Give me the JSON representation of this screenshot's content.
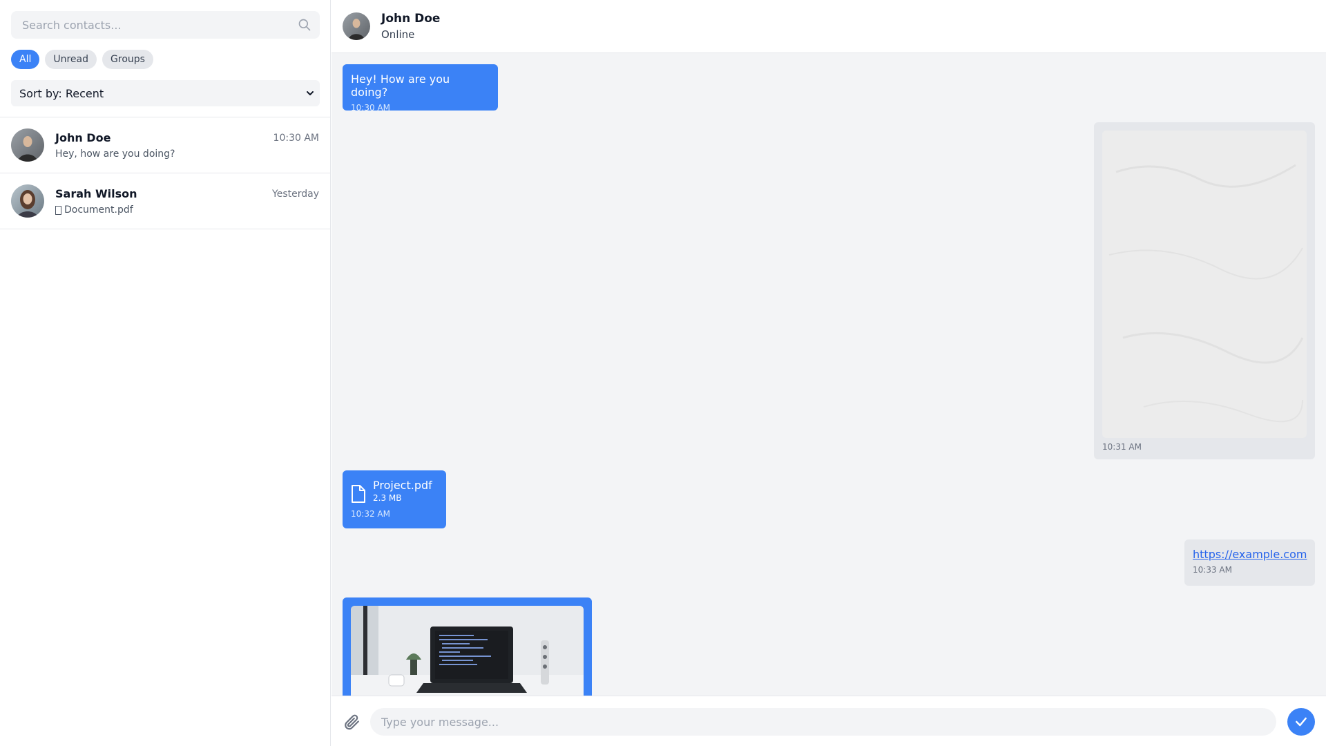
{
  "sidebar": {
    "search": {
      "placeholder": "Search contacts...",
      "value": ""
    },
    "filters": [
      {
        "label": "All",
        "active": true
      },
      {
        "label": "Unread",
        "active": false
      },
      {
        "label": "Groups",
        "active": false
      }
    ],
    "sort": {
      "selected": "Sort by: Recent"
    },
    "contacts": [
      {
        "name": "John Doe",
        "time": "10:30 AM",
        "preview": "Hey, how are you doing?"
      },
      {
        "name": "Sarah Wilson",
        "time": "Yesterday",
        "preview": "Document.pdf"
      }
    ]
  },
  "chat": {
    "header": {
      "name": "John Doe",
      "status": "Online"
    },
    "messages": [
      {
        "type": "text",
        "direction": "incoming",
        "text": "Hey! How are you doing?",
        "time": "10:30 AM"
      },
      {
        "type": "image",
        "direction": "outgoing",
        "time": "10:31 AM"
      },
      {
        "type": "file",
        "direction": "incoming",
        "file_name": "Project.pdf",
        "file_size": "2.3 MB",
        "time": "10:32 AM"
      },
      {
        "type": "link",
        "direction": "outgoing",
        "url": "https://example.com",
        "time": "10:33 AM"
      },
      {
        "type": "image",
        "direction": "incoming"
      }
    ],
    "composer": {
      "placeholder": "Type your message...",
      "value": ""
    }
  },
  "colors": {
    "accent": "#3b82f6",
    "chat_background": "#f3f4f6",
    "outgoing_bubble": "#e5e7eb",
    "link": "#2563eb"
  },
  "icons": {
    "search": "search-icon",
    "sort_chevron": "chevron-down-icon",
    "file": "file-icon",
    "attach": "paperclip-icon",
    "send": "check-icon"
  }
}
